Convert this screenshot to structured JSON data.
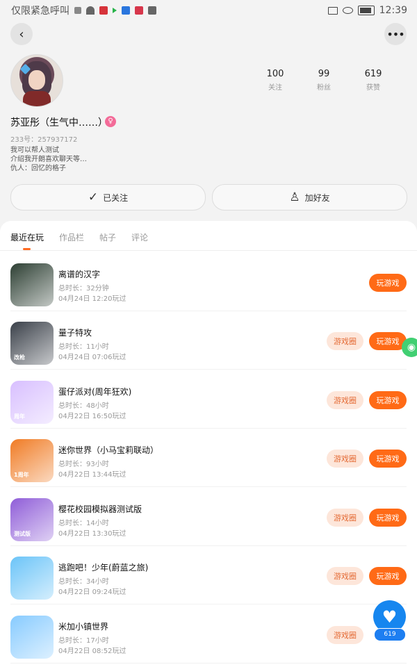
{
  "status_bar": {
    "left_text": "仅限紧急呼叫",
    "time": "12:39"
  },
  "header": {
    "back_icon": "chevron-left-icon",
    "more_icon": "ellipsis-icon"
  },
  "profile": {
    "name": "苏亚彤（生气中……）",
    "uid": "233号：257937172",
    "bio": [
      "我可以帮人测试",
      "介绍我开朗喜欢聊天等…",
      "仇人：回忆的格子"
    ],
    "stats": [
      {
        "num": "100",
        "label": "关注"
      },
      {
        "num": "99",
        "label": "粉丝"
      },
      {
        "num": "619",
        "label": "获赞"
      }
    ],
    "followed_label": "已关注",
    "add_friend_label": "加好友"
  },
  "tabs": [
    "最近在玩",
    "作品栏",
    "帖子",
    "评论"
  ],
  "games": [
    {
      "title": "离谱的汉字",
      "time": "总时长：32分钟",
      "date": "04月24日 12:20玩过",
      "circle": "",
      "play": "玩游戏",
      "cover_color": "#2d3f33",
      "cover_label": ""
    },
    {
      "title": "量子特攻",
      "time": "总时长：11小时",
      "date": "04月24日 07:06玩过",
      "circle": "游戏圈",
      "play": "玩游戏",
      "cover_color": "#3a4049",
      "cover_label": "改枪"
    },
    {
      "title": "蛋仔派对(周年狂欢)",
      "time": "总时长：48小时",
      "date": "04月22日 16:50玩过",
      "circle": "游戏圈",
      "play": "玩游戏",
      "cover_color": "#d8bfff",
      "cover_label": "周年"
    },
    {
      "title": "迷你世界（小马宝莉联动）",
      "time": "总时长：93小时",
      "date": "04月22日 13:44玩过",
      "circle": "游戏圈",
      "play": "玩游戏",
      "cover_color": "#f07b24",
      "cover_label": "1周年"
    },
    {
      "title": "樱花校园模拟器测试版",
      "time": "总时长：14小时",
      "date": "04月22日 13:30玩过",
      "circle": "游戏圈",
      "play": "玩游戏",
      "cover_color": "#8f5dd8",
      "cover_label": "测试版"
    },
    {
      "title": "逃跑吧！少年(蔚蓝之旅)",
      "time": "总时长：34小时",
      "date": "04月22日 09:24玩过",
      "circle": "游戏圈",
      "play": "玩游戏",
      "cover_color": "#6bc4f8",
      "cover_label": ""
    },
    {
      "title": "米加小镇世界",
      "time": "总时长：17小时",
      "date": "04月22日 08:52玩过",
      "circle": "游戏圈",
      "play": "",
      "cover_color": "#87cbff",
      "cover_label": ""
    }
  ],
  "floating": {
    "count": "619"
  }
}
